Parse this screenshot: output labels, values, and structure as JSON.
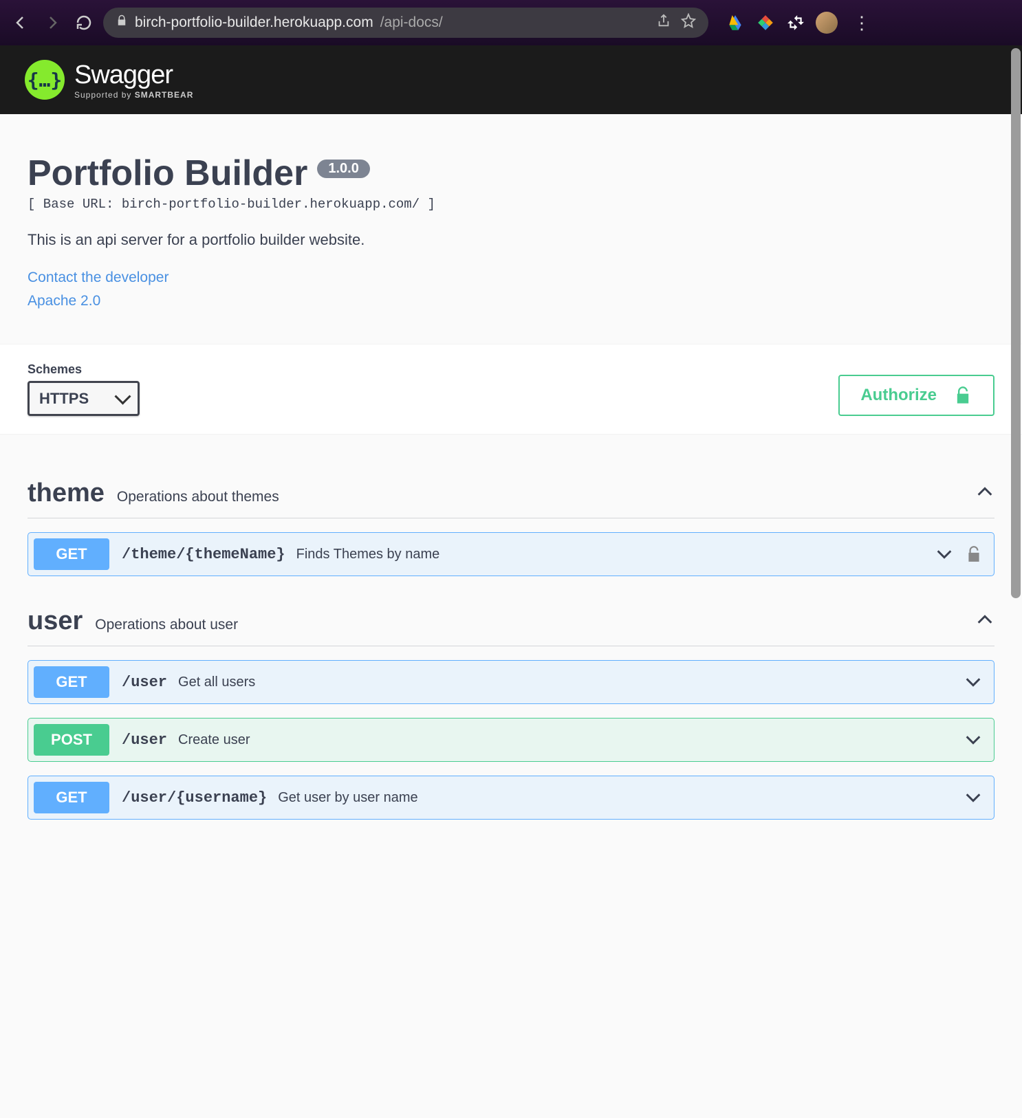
{
  "browser": {
    "url_host": "birch-portfolio-builder.herokuapp.com",
    "url_path": "/api-docs/"
  },
  "header": {
    "brand": "Swagger",
    "supported_by_prefix": "Supported by ",
    "supported_by_brand": "SMARTBEAR"
  },
  "info": {
    "title": "Portfolio Builder",
    "version": "1.0.0",
    "base_url_prefix": "[ Base URL: ",
    "base_url": "birch-portfolio-builder.herokuapp.com/",
    "base_url_suffix": " ]",
    "description": "This is an api server for a portfolio builder website.",
    "contact_link": "Contact the developer",
    "license_link": "Apache 2.0"
  },
  "schemes": {
    "label": "Schemes",
    "selected": "HTTPS"
  },
  "authorize": {
    "label": "Authorize"
  },
  "tags": [
    {
      "name": "theme",
      "description": "Operations about themes",
      "operations": [
        {
          "method": "GET",
          "path": "/theme/{themeName}",
          "summary": "Finds Themes by name",
          "auth": true
        }
      ]
    },
    {
      "name": "user",
      "description": "Operations about user",
      "operations": [
        {
          "method": "GET",
          "path": "/user",
          "summary": "Get all users",
          "auth": false
        },
        {
          "method": "POST",
          "path": "/user",
          "summary": "Create user",
          "auth": false
        },
        {
          "method": "GET",
          "path": "/user/{username}",
          "summary": "Get user by user name",
          "auth": false
        }
      ]
    }
  ]
}
